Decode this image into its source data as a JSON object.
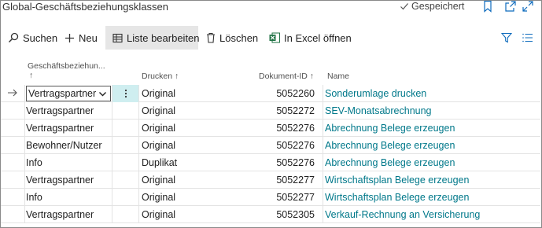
{
  "window": {
    "title": "Global-Geschäftsbeziehungsklassen",
    "saved_status": "Gespeichert"
  },
  "toolbar": {
    "search_label": "Suchen",
    "new_label": "Neu",
    "edit_list_label": "Liste bearbeiten",
    "delete_label": "Löschen",
    "excel_label": "In Excel öffnen"
  },
  "table": {
    "headers": {
      "type": "Geschäftsbeziehun...",
      "type_sort": "↑",
      "print": "Drucken ↑",
      "doc_id": "Dokument-ID ↑",
      "name": "Name"
    },
    "rows": [
      {
        "type": "Vertragspartner",
        "print": "Original",
        "doc_id": "5052260",
        "name": "Sonderumlage drucken"
      },
      {
        "type": "Vertragspartner",
        "print": "Original",
        "doc_id": "5052272",
        "name": "SEV-Monatsabrechnung"
      },
      {
        "type": "Vertragspartner",
        "print": "Original",
        "doc_id": "5052276",
        "name": "Abrechnung Belege erzeugen"
      },
      {
        "type": "Bewohner/Nutzer",
        "print": "Original",
        "doc_id": "5052276",
        "name": "Abrechnung Belege erzeugen"
      },
      {
        "type": "Info",
        "print": "Duplikat",
        "doc_id": "5052276",
        "name": "Abrechnung Belege erzeugen"
      },
      {
        "type": "Vertragspartner",
        "print": "Original",
        "doc_id": "5052277",
        "name": "Wirtschaftsplan Belege erzeugen"
      },
      {
        "type": "Info",
        "print": "Original",
        "doc_id": "5052277",
        "name": "Wirtschaftsplan Belege erzeugen"
      },
      {
        "type": "Vertragspartner",
        "print": "Original",
        "doc_id": "5052305",
        "name": "Verkauf-Rechnung an Versicherung"
      }
    ]
  },
  "colors": {
    "link": "#00788a",
    "active_cell": "#cfeef0",
    "accent": "#0f6cbd",
    "excel_green": "#217346"
  }
}
